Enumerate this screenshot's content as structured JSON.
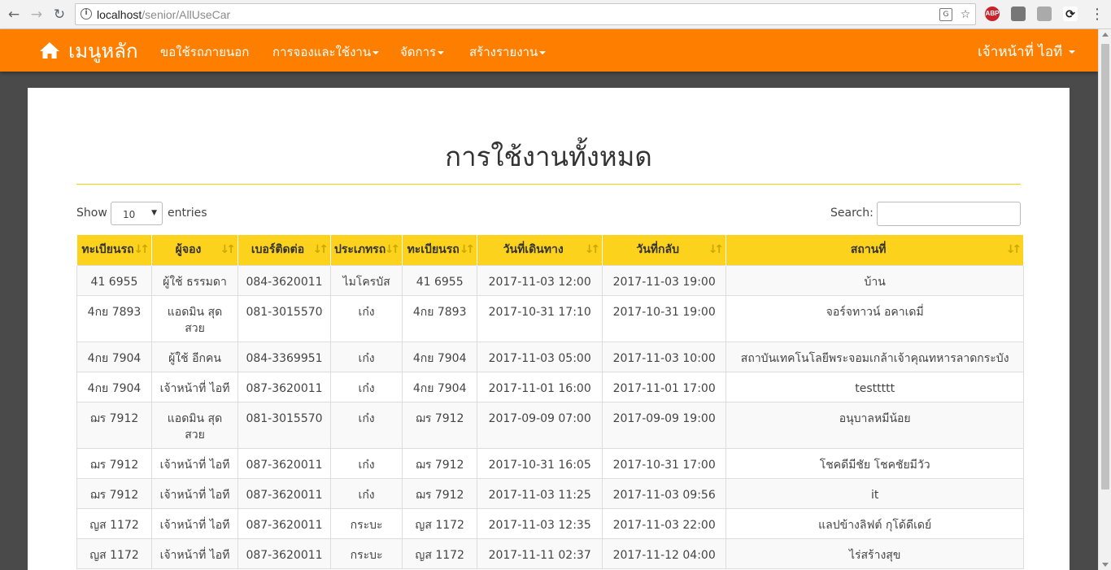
{
  "browser": {
    "url_host": "localhost",
    "url_path": "/senior/AllUseCar",
    "ext_abp": "ABP"
  },
  "navbar": {
    "brand": "เมนูหลัก",
    "items": [
      {
        "label": "ขอใช้รถภายนอก"
      },
      {
        "label": "การจองและใช้งาน"
      },
      {
        "label": "จัดการ"
      },
      {
        "label": "สร้างรายงาน"
      }
    ],
    "user": "เจ้าหน้าที่ ไอที"
  },
  "page": {
    "title": "การใช้งานทั้งหมด",
    "show_label": "Show",
    "length_value": "10",
    "entries_label": "entries",
    "search_label": "Search:"
  },
  "table": {
    "headers": [
      "ทะเบียนรถ",
      "ผู้จอง",
      "เบอร์ติดต่อ",
      "ประเภทรถ",
      "ทะเบียนรถ",
      "วันที่เดินทาง",
      "วันที่กลับ",
      "สถานที่"
    ],
    "rows": [
      [
        "41 6955",
        "ผู้ใช้ ธรรมดา",
        "084-3620011",
        "ไมโครบัส",
        "41 6955",
        "2017-11-03 12:00",
        "2017-11-03 19:00",
        "บ้าน"
      ],
      [
        "4กย 7893",
        "แอดมิน สุด สวย",
        "081-3015570",
        "เก๋ง",
        "4กย 7893",
        "2017-10-31 17:10",
        "2017-10-31 19:00",
        "จอร์จทาวน์ อคาเดมี่"
      ],
      [
        "4กย 7904",
        "ผู้ใช้ อีกคน",
        "084-3369951",
        "เก๋ง",
        "4กย 7904",
        "2017-11-03 05:00",
        "2017-11-03 10:00",
        "สถาบันเทคโนโลยีพระจอมเกล้าเจ้าคุณทหารลาดกระบัง"
      ],
      [
        "4กย 7904",
        "เจ้าหน้าที่ ไอที",
        "087-3620011",
        "เก๋ง",
        "4กย 7904",
        "2017-11-01 16:00",
        "2017-11-01 17:00",
        "testtttt"
      ],
      [
        "ฌร 7912",
        "แอดมิน สุด สวย",
        "081-3015570",
        "เก๋ง",
        "ฌร 7912",
        "2017-09-09 07:00",
        "2017-09-09 19:00",
        "อนุบาลหมีน้อย"
      ],
      [
        "ฌร 7912",
        "เจ้าหน้าที่ ไอที",
        "087-3620011",
        "เก๋ง",
        "ฌร 7912",
        "2017-10-31 16:05",
        "2017-10-31 17:00",
        "โชคดีมีชัย โชคชัยมีวัว"
      ],
      [
        "ฌร 7912",
        "เจ้าหน้าที่ ไอที",
        "087-3620011",
        "เก๋ง",
        "ฌร 7912",
        "2017-11-03 11:25",
        "2017-11-03 09:56",
        "it"
      ],
      [
        "ญส 1172",
        "เจ้าหน้าที่ ไอที",
        "087-3620011",
        "กระบะ",
        "ญส 1172",
        "2017-11-03 12:35",
        "2017-11-03 22:00",
        "แลปข้างลิฟต์ กุโด้ดีเดย์"
      ],
      [
        "ญส 1172",
        "เจ้าหน้าที่ ไอที",
        "087-3620011",
        "กระบะ",
        "ญส 1172",
        "2017-11-11 02:37",
        "2017-11-12 04:00",
        "ไร่สร้างสุข"
      ]
    ]
  },
  "colors": {
    "navbar": "#fe7f00",
    "table_header": "#fdd21c",
    "title_rule": "#f5d300"
  }
}
